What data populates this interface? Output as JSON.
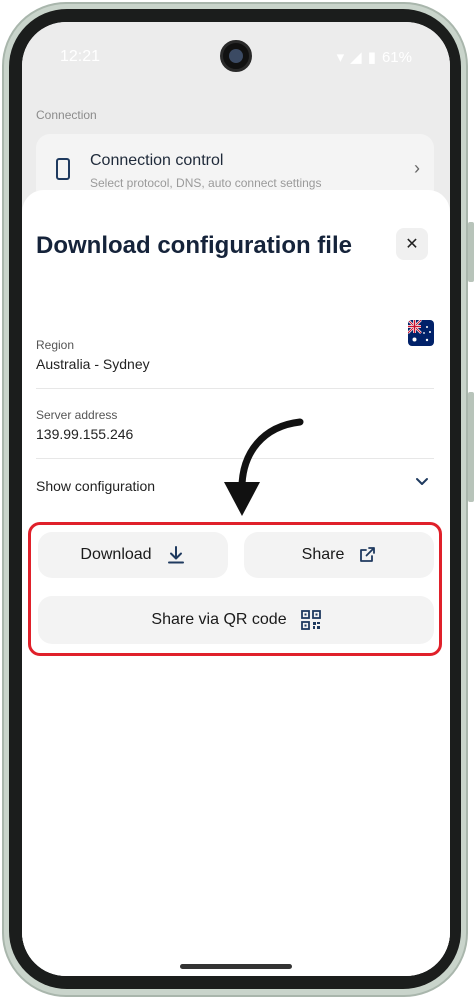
{
  "status_bar": {
    "time": "12:21",
    "battery": "61%"
  },
  "background": {
    "section_label": "Connection",
    "connection_control": {
      "title": "Connection control",
      "subtitle": "Select protocol, DNS, auto connect settings"
    }
  },
  "sheet": {
    "title": "Download configuration file",
    "close_label": "✕",
    "region": {
      "label": "Region",
      "value": "Australia - Sydney"
    },
    "server": {
      "label": "Server address",
      "value": "139.99.155.246"
    },
    "show_config_label": "Show configuration",
    "buttons": {
      "download": "Download",
      "share": "Share",
      "share_qr": "Share via QR code"
    }
  },
  "annotation": {
    "highlight_color": "#e0202a"
  },
  "colors": {
    "accent": "#15233a"
  }
}
